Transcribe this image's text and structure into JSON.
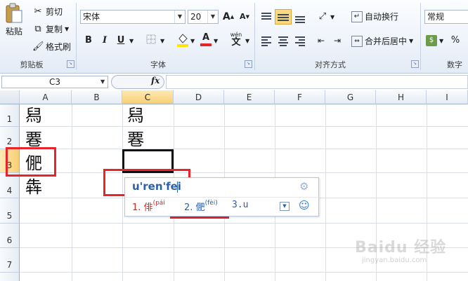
{
  "ribbon": {
    "clipboard": {
      "paste": "粘贴",
      "cut": "剪切",
      "copy": "复制",
      "format_painter": "格式刷",
      "group_label": "剪贴板"
    },
    "font": {
      "font_name": "宋体",
      "font_size": "20",
      "grow_icon": "A",
      "shrink_icon": "A",
      "bold": "B",
      "italic": "I",
      "underline": "U",
      "font_color_letter": "A",
      "phonetic": "wén",
      "phonetic_char": "文",
      "group_label": "字体"
    },
    "alignment": {
      "wrap_text": "自动换行",
      "merge_center": "合并后居中",
      "group_label": "对齐方式"
    },
    "number": {
      "format": "常规",
      "percent": "%",
      "group_label": "数字"
    }
  },
  "formula_bar": {
    "name_box": "C3",
    "fx": "fx"
  },
  "columns": [
    "A",
    "B",
    "C",
    "D",
    "E",
    "F",
    "G",
    "H",
    "I"
  ],
  "rows": [
    "1",
    "2",
    "3",
    "4",
    "5",
    "6",
    "7"
  ],
  "cells": {
    "A1": "舄",
    "A2": "䙴",
    "A3": "俷",
    "A4": "犇",
    "C1": "舄",
    "C2": "䙴"
  },
  "ime": {
    "input": "u'ren'fei",
    "candidates": [
      {
        "num": "1.",
        "char": "俳",
        "pinyin": "(pái"
      },
      {
        "num": "2.",
        "char": "俷",
        "pinyin": "(fèi)"
      },
      {
        "num": "3.",
        "char": "u",
        "pinyin": ""
      }
    ]
  },
  "watermark": {
    "brand": "Baidu 经验",
    "sub": "jingyan.baidu.com"
  },
  "colors": {
    "highlight_red": "#e8232a",
    "ime_blue": "#2d5ea8",
    "ime_red": "#e02020",
    "selected_header": "#f8cf72"
  }
}
